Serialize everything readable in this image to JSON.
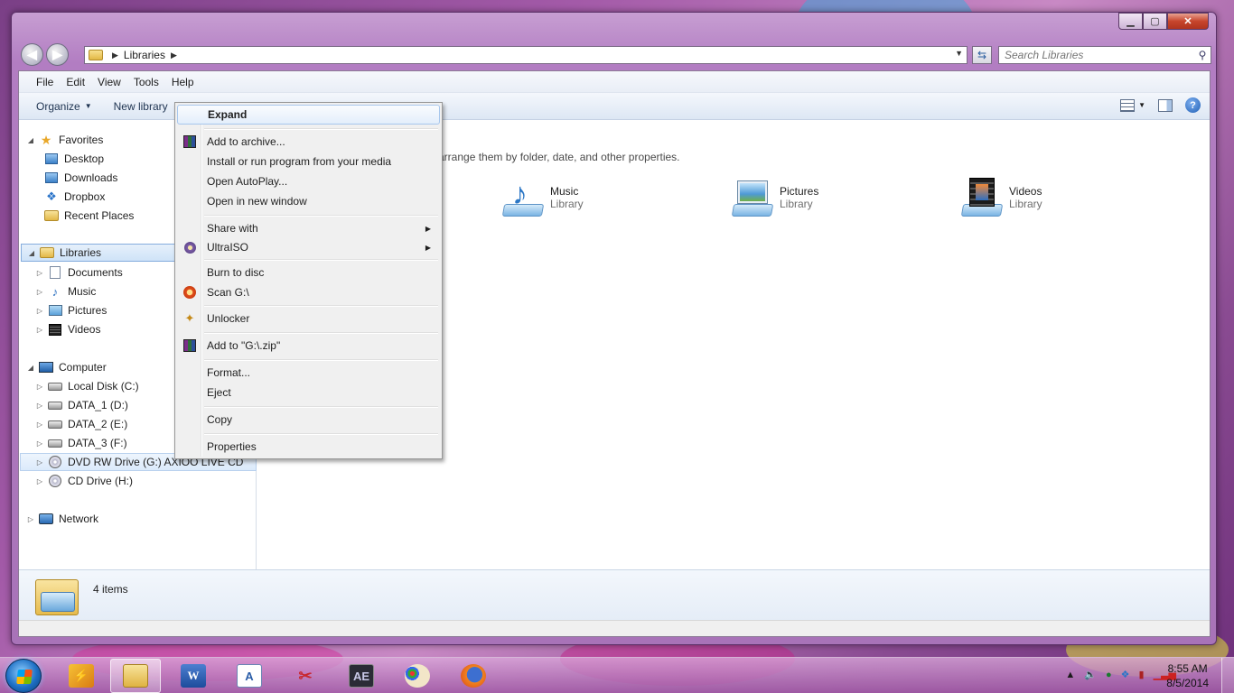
{
  "window": {
    "address": {
      "crumb": "Libraries"
    },
    "search_placeholder": "Search Libraries"
  },
  "menubar": [
    "File",
    "Edit",
    "View",
    "Tools",
    "Help"
  ],
  "commandbar": {
    "organize": "Organize",
    "new_library": "New library"
  },
  "navpane": {
    "favorites": {
      "label": "Favorites",
      "items": [
        "Desktop",
        "Downloads",
        "Dropbox",
        "Recent Places"
      ]
    },
    "libraries": {
      "label": "Libraries",
      "items": [
        "Documents",
        "Music",
        "Pictures",
        "Videos"
      ]
    },
    "computer": {
      "label": "Computer",
      "items": [
        "Local Disk (C:)",
        "DATA_1 (D:)",
        "DATA_2 (E:)",
        "DATA_3 (F:)",
        "DVD RW Drive (G:) AXIOO LIVE CD",
        "CD Drive (H:)"
      ]
    },
    "network": {
      "label": "Network"
    }
  },
  "content": {
    "subtitle_fragment": "arrange them by folder, date, and other properties.",
    "libraries": [
      {
        "name": "Music",
        "type": "Library"
      },
      {
        "name": "Pictures",
        "type": "Library"
      },
      {
        "name": "Videos",
        "type": "Library"
      }
    ]
  },
  "details": {
    "count": "4 items"
  },
  "context_menu": {
    "expand": "Expand",
    "add_archive": "Add to archive...",
    "install_run": "Install or run program from your media",
    "open_autoplay": "Open AutoPlay...",
    "open_new_window": "Open in new window",
    "share_with": "Share with",
    "ultraiso": "UltraISO",
    "burn": "Burn to disc",
    "scan": "Scan G:\\",
    "unlocker": "Unlocker",
    "add_zip": "Add to \"G:\\.zip\"",
    "format": "Format...",
    "eject": "Eject",
    "copy": "Copy",
    "properties": "Properties"
  },
  "taskbar": {
    "apps": [
      "winamp-icon",
      "explorer-icon",
      "word-icon",
      "wordpad-icon",
      "snipping-icon",
      "after-effects-icon",
      "paint-icon",
      "firefox-icon"
    ],
    "after_effects_label": "AE",
    "time": "8:55 AM",
    "date": "8/5/2014"
  },
  "colors": {
    "accent": "#2a74c9",
    "window_frame": "#b27dc2",
    "close": "#c7452c"
  }
}
